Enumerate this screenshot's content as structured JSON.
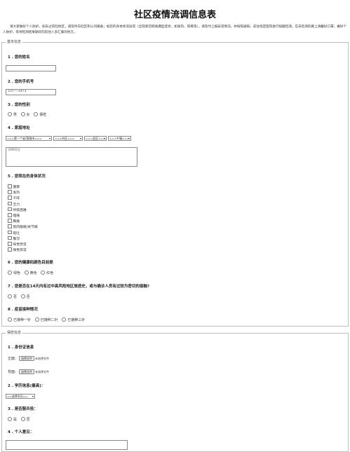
{
  "title": "社区疫情流调信息表",
  "intro": "请大家做好个人防护。如去过风险地区，请及时向社区和公司报备；如您的身体状况异常（出现新冠病毒典型症状，如发热、咳嗽等），请及时上报异常情况，并按照通知，前往指定医院进行核酸检测。在去检测的路上请戴好口罩，做好个人防护，等待检测结果期间勿前往人多汇集的地方。",
  "basic": {
    "legend": "基本信息",
    "q1": {
      "label": "1 . 您的姓名",
      "value": ""
    },
    "q2": {
      "label": "2 . 您的手机号",
      "value": "137----2473"
    },
    "q3": {
      "label": "3 . 您的性别",
      "options": [
        "男",
        "女",
        "保密"
      ]
    },
    "q4": {
      "label": "4 . 家庭地址",
      "selects": [
        "===第一个省/直辖市===",
        "===市区===",
        "===县区===",
        "===乡镇==="
      ],
      "textarea_placeholder": "详细地址"
    },
    "q5": {
      "label": "5 . 您现在的身体状况",
      "options": [
        "健康",
        "发热",
        "干咳",
        "乏力",
        "呼吸困难",
        "咽痛",
        "胸痛",
        "肌肉酸痛/关节痛",
        "呕吐",
        "腹泻",
        "味觉异常",
        "嗅觉异常"
      ]
    },
    "q6": {
      "label": "6 . 您的健康码颜色目前是",
      "options": [
        "绿色",
        "黄色",
        "红色"
      ]
    },
    "q7": {
      "label": "7 . 您是否在14天内有过中高风险地区旅居史，或与确诊人员有过较为密切的接触?",
      "options": [
        "否",
        "否"
      ]
    },
    "q8": {
      "label": "8 . 疫苗接种情况",
      "options": [
        "已接种一针",
        "已接种二针",
        "已接种三针"
      ]
    }
  },
  "secret": {
    "legend": "保密信息",
    "q1": {
      "label": "1 . 身份证信息",
      "front_label": "正面：",
      "back_label": "背面：",
      "button": "选择文件",
      "no_file": "未选择文件"
    },
    "q2": {
      "label": "2 . 学历信息(最高)：",
      "select": "==选择学历=="
    },
    "q3": {
      "label": "3 . 是否服兵役：",
      "options": [
        "是",
        "否"
      ]
    },
    "q4": {
      "label": "4 . 个人意见："
    }
  }
}
